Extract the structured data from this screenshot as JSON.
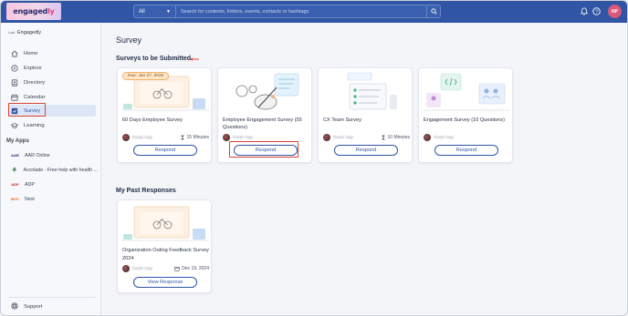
{
  "brand": {
    "logo_text_a": "engaged",
    "logo_text_b": "ly"
  },
  "header": {
    "search_category": "All",
    "search_placeholder": "Search for contents, folders, events, contacts or hashtags",
    "user_initials": "NP"
  },
  "sidebar": {
    "org_logo": "Lord",
    "org_name": "Engagedly",
    "nav": [
      {
        "label": "Home",
        "icon": "home-icon"
      },
      {
        "label": "Explore",
        "icon": "compass-icon"
      },
      {
        "label": "Directory",
        "icon": "directory-icon"
      },
      {
        "label": "Calendar",
        "icon": "calendar-icon"
      },
      {
        "label": "Survey",
        "icon": "survey-icon",
        "active": true
      },
      {
        "label": "Learning",
        "icon": "graduation-cap-icon"
      }
    ],
    "apps_title": "My Apps",
    "apps": [
      {
        "logo": "AAR",
        "label": "AAR Online"
      },
      {
        "logo": "⚘",
        "label": "Accolade - Free help with health ..."
      },
      {
        "logo": "ADP",
        "label": "ADP"
      },
      {
        "logo": "NEXT",
        "label": "Next"
      }
    ],
    "support_label": "Support"
  },
  "main": {
    "page_title": "Survey",
    "to_submit_title": "Surveys to be Submitted",
    "surveys": [
      {
        "title": "60 Days Employee Survey",
        "date_tag": "Due: Jan 27, 2025",
        "user": "Ranjit Vagi",
        "duration": "15 Minutes",
        "button": "Respond"
      },
      {
        "title": "Employee Engagement Survey (55 Questions)",
        "user": "Ranjit Vagi",
        "duration": "",
        "button": "Respond"
      },
      {
        "title": "CX Team Survey",
        "user": "Ranjit Vagi",
        "duration": "10 Minutes",
        "button": "Respond"
      },
      {
        "title": "Engagement Survey (10 Questions)",
        "user": "Ranjit Vagi",
        "duration": "",
        "button": "Respond"
      }
    ],
    "past_title": "My Past Responses",
    "past": {
      "title": "Organization Outing Feedback Survey 2024",
      "user": "Ranjit Vagi",
      "date": "Dec 19, 2024",
      "button": "View Response"
    }
  },
  "colors": {
    "primary": "#2f55a4",
    "highlight": "#d9432f"
  }
}
